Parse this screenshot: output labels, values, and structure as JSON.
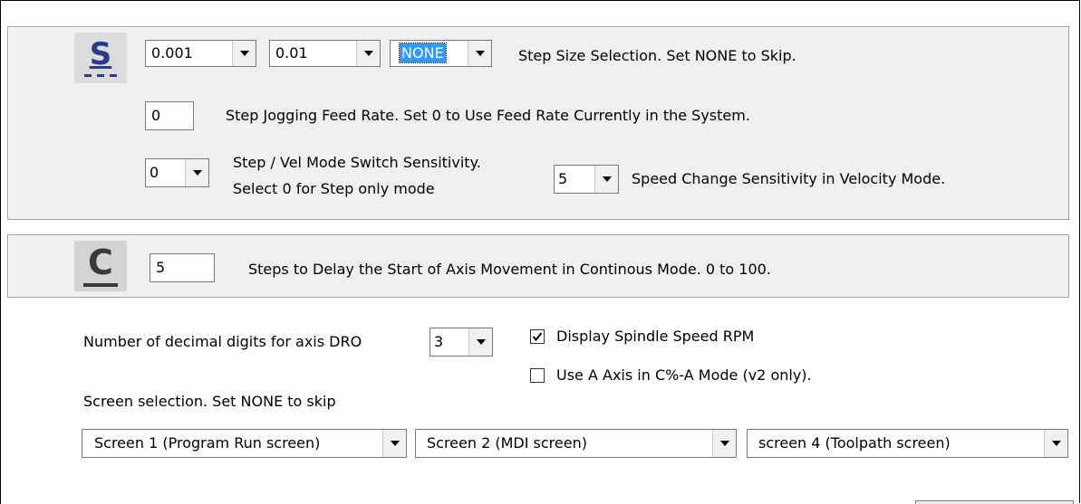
{
  "step": {
    "icon_letter": "S",
    "size1": "0.001",
    "size2": "0.01",
    "size3": "NONE",
    "size_label": "Step Size Selection. Set NONE to Skip.",
    "feed_rate_value": "0",
    "feed_rate_label": "Step Jogging Feed Rate. Set 0 to Use Feed Rate Currently in the System.",
    "switch_sensitivity_value": "0",
    "switch_sensitivity_label_line1": "Step / Vel  Mode Switch Sensitivity.",
    "switch_sensitivity_label_line2": "Select 0 for Step only mode",
    "speed_sensitivity_value": "5",
    "speed_sensitivity_label": "Speed Change Sensitivity in Velocity Mode.",
    "icon_color": "#2a3a8c"
  },
  "continuous": {
    "icon_letter": "C",
    "delay_value": "5",
    "delay_label": "Steps to Delay the Start of Axis Movement in Continous Mode. 0 to 100."
  },
  "options": {
    "decimal_label": "Number of decimal digits for axis DRO",
    "decimal_value": "3",
    "display_rpm_label": "Display Spindle Speed RPM",
    "display_rpm_checked": true,
    "a_axis_label": "Use A Axis in C%-A Mode (v2 only).",
    "a_axis_checked": false,
    "screen_label": "Screen selection. Set NONE to skip",
    "screen1": "Screen 1 (Program Run screen)",
    "screen2": "Screen 2 (MDI screen)",
    "screen3": "screen 4 (Toolpath screen)"
  }
}
